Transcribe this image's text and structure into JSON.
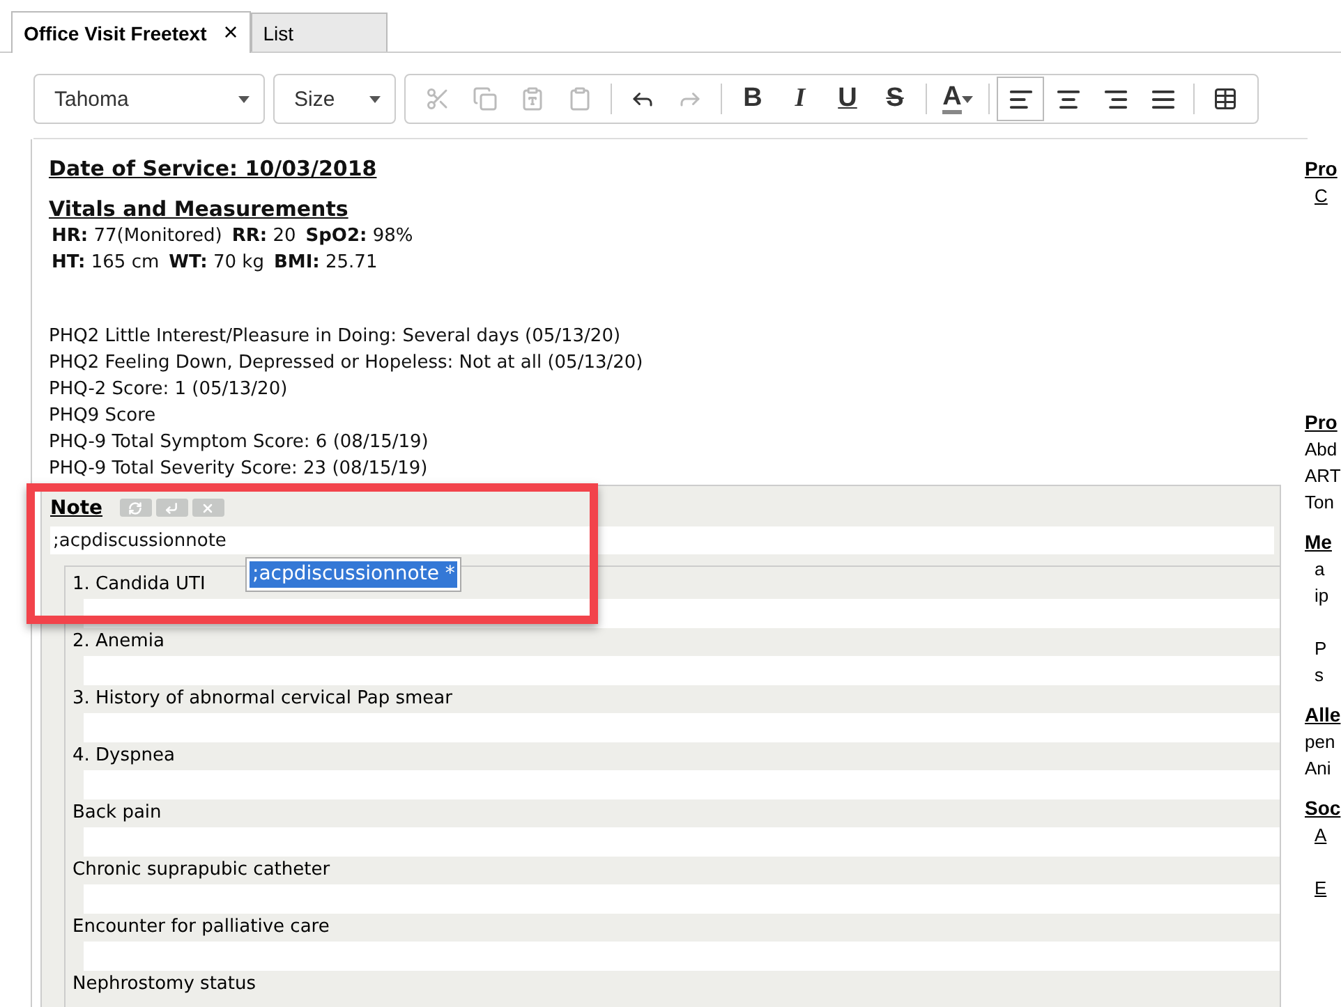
{
  "tabs": [
    {
      "label": "Office Visit Freetext",
      "selected": true,
      "close_glyph": "×"
    },
    {
      "label": "List",
      "selected": false
    }
  ],
  "toolbar": {
    "font": "Tahoma",
    "size": "Size",
    "groups": [
      [
        {
          "kind": "icon",
          "disabled": true
        },
        {
          "kind": "icon",
          "disabled": true
        },
        {
          "kind": "icon",
          "disabled": true
        },
        {
          "kind": "icon",
          "disabled": true
        }
      ],
      [
        {
          "kind": "icon",
          "disabled": false
        },
        {
          "kind": "icon",
          "disabled": true
        }
      ],
      [
        {
          "kind": "text",
          "label": "B"
        },
        {
          "kind": "text",
          "label": "I"
        },
        {
          "kind": "text",
          "label": "U"
        },
        {
          "kind": "text",
          "label": "S"
        }
      ],
      [
        {
          "kind": "color",
          "label": "A"
        }
      ],
      [
        {
          "kind": "align",
          "selected": true
        },
        {
          "kind": "align",
          "selected": false
        },
        {
          "kind": "align",
          "selected": false
        },
        {
          "kind": "align",
          "selected": false
        }
      ],
      [
        {
          "kind": "icon",
          "disabled": false
        }
      ]
    ]
  },
  "document": {
    "date_heading": "Date of Service: 10/03/2018",
    "vitals_heading": "Vitals and Measurements",
    "vitals": [
      [
        {
          "label": "HR:",
          "value": "77(Monitored)"
        },
        {
          "label": "RR:",
          "value": "20"
        },
        {
          "label": "SpO2:",
          "value": "98%"
        }
      ],
      [
        {
          "label": "HT:",
          "value": "165 cm"
        },
        {
          "label": "WT:",
          "value": "70 kg"
        },
        {
          "label": "BMI:",
          "value": "25.71"
        }
      ]
    ],
    "phq_lines": [
      "PHQ2 Little Interest/Pleasure in Doing: Several days (05/13/20)",
      "PHQ2 Feeling Down, Depressed or Hopeless: Not at all (05/13/20)",
      "PHQ-2 Score: 1 (05/13/20)",
      "PHQ9 Score",
      "PHQ-9 Total Symptom Score: 6 (08/15/19)",
      "PHQ-9 Total Severity Score: 23 (08/15/19)"
    ],
    "note": {
      "title": "Note",
      "value": ";acpdiscussionnote",
      "suggestions": [
        {
          "label": ";acpdiscussionnote *",
          "selected": true
        }
      ],
      "problems": [
        "1. Candida UTI",
        "2. Anemia",
        "3. History of abnormal cervical Pap smear",
        "4. Dyspnea",
        "Back pain",
        "Chronic suprapubic catheter",
        "Encounter for palliative care",
        "Nephrostomy status"
      ]
    }
  },
  "side_panel": [
    {
      "heading": "Pro",
      "paragraphs": [
        [
          {
            "kind": "link",
            "text": "C"
          }
        ]
      ]
    },
    {
      "heading": "Pro",
      "paragraphs": [
        [
          {
            "kind": "line",
            "text": "Abd"
          },
          {
            "kind": "line",
            "text": "ART"
          },
          {
            "kind": "line",
            "text": "Ton"
          }
        ]
      ]
    },
    {
      "heading": "Me",
      "paragraphs": [
        [
          {
            "kind": "indent",
            "text": "a"
          },
          {
            "kind": "indent",
            "text": "ip"
          }
        ],
        [
          {
            "kind": "indent",
            "text": "P"
          },
          {
            "kind": "indent",
            "text": "s"
          }
        ]
      ]
    },
    {
      "heading": "Alle",
      "paragraphs": [
        [
          {
            "kind": "line",
            "text": "pen"
          },
          {
            "kind": "line",
            "text": "Ani"
          }
        ]
      ]
    },
    {
      "heading": "Soc",
      "paragraphs": [
        [
          {
            "kind": "link",
            "text": "A"
          }
        ],
        [
          {
            "kind": "link",
            "text": "E"
          }
        ]
      ]
    }
  ]
}
